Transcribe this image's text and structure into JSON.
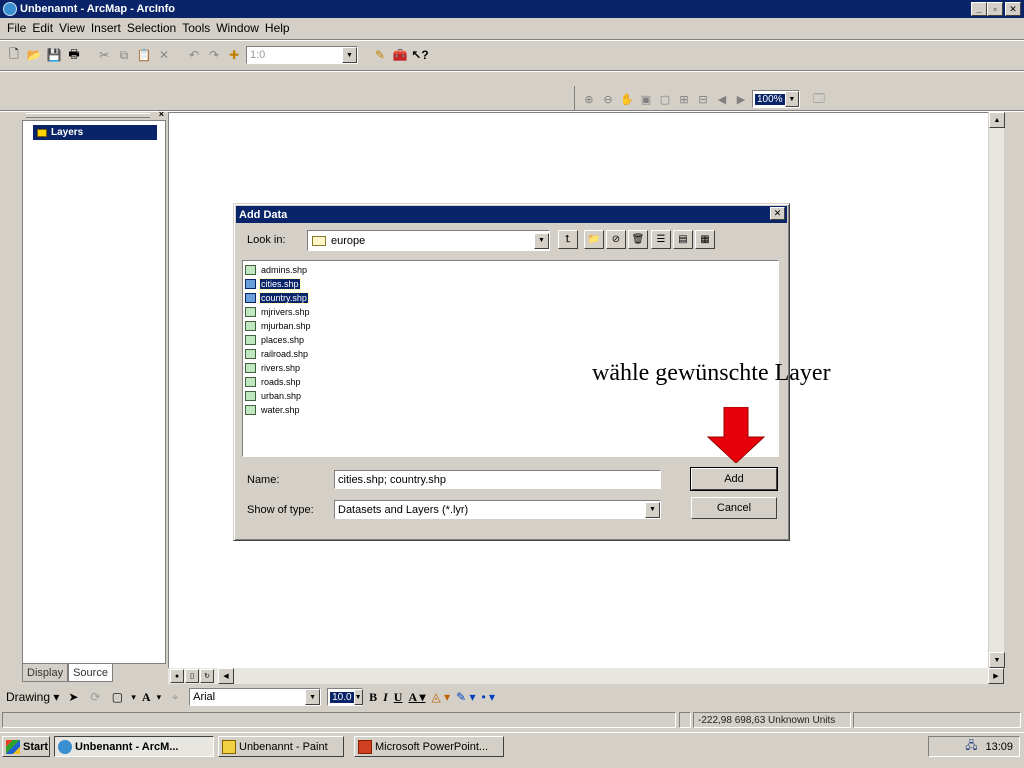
{
  "window": {
    "title": "Unbenannt - ArcMap - ArcInfo"
  },
  "menu": [
    "File",
    "Edit",
    "View",
    "Insert",
    "Selection",
    "Tools",
    "Window",
    "Help"
  ],
  "toolbar": {
    "scale": "1:0"
  },
  "layout_toolbar": {
    "zoom": "100%"
  },
  "toc": {
    "root_label": "Layers",
    "tabs": [
      "Display",
      "Source"
    ],
    "active_tab": "Display"
  },
  "dialog": {
    "title": "Add Data",
    "look_in_label": "Look in:",
    "look_in_value": "europe",
    "files": [
      {
        "name": "admins.shp",
        "selected": false
      },
      {
        "name": "cities.shp",
        "selected": true
      },
      {
        "name": "country.shp",
        "selected": true
      },
      {
        "name": "mjrivers.shp",
        "selected": false
      },
      {
        "name": "mjurban.shp",
        "selected": false
      },
      {
        "name": "places.shp",
        "selected": false
      },
      {
        "name": "railroad.shp",
        "selected": false
      },
      {
        "name": "rivers.shp",
        "selected": false
      },
      {
        "name": "roads.shp",
        "selected": false
      },
      {
        "name": "urban.shp",
        "selected": false
      },
      {
        "name": "water.shp",
        "selected": false
      }
    ],
    "name_label": "Name:",
    "name_value": "cities.shp; country.shp",
    "type_label": "Show of type:",
    "type_value": "Datasets and Layers (*.lyr)",
    "add_button": "Add",
    "cancel_button": "Cancel"
  },
  "annotation": {
    "text": "wähle gewünschte Layer",
    "arrow_color": "#e8000a"
  },
  "drawing_toolbar": {
    "drawing_label": "Drawing",
    "font": "Arial",
    "font_size": "10.0"
  },
  "status": {
    "coordinates": "-222,98  698,63 Unknown Units"
  },
  "taskbar": {
    "start": "Start",
    "tasks": [
      {
        "label": "Unbenannt - ArcM...",
        "active": true
      },
      {
        "label": "Unbenannt - Paint",
        "active": false
      },
      {
        "label": "Microsoft PowerPoint...",
        "active": false
      }
    ],
    "clock": "13:09"
  },
  "colors": {
    "title_bar": "#0a246a",
    "face": "#d4d0c8",
    "selection": "#0a246a",
    "arrow": "#e8000a"
  }
}
